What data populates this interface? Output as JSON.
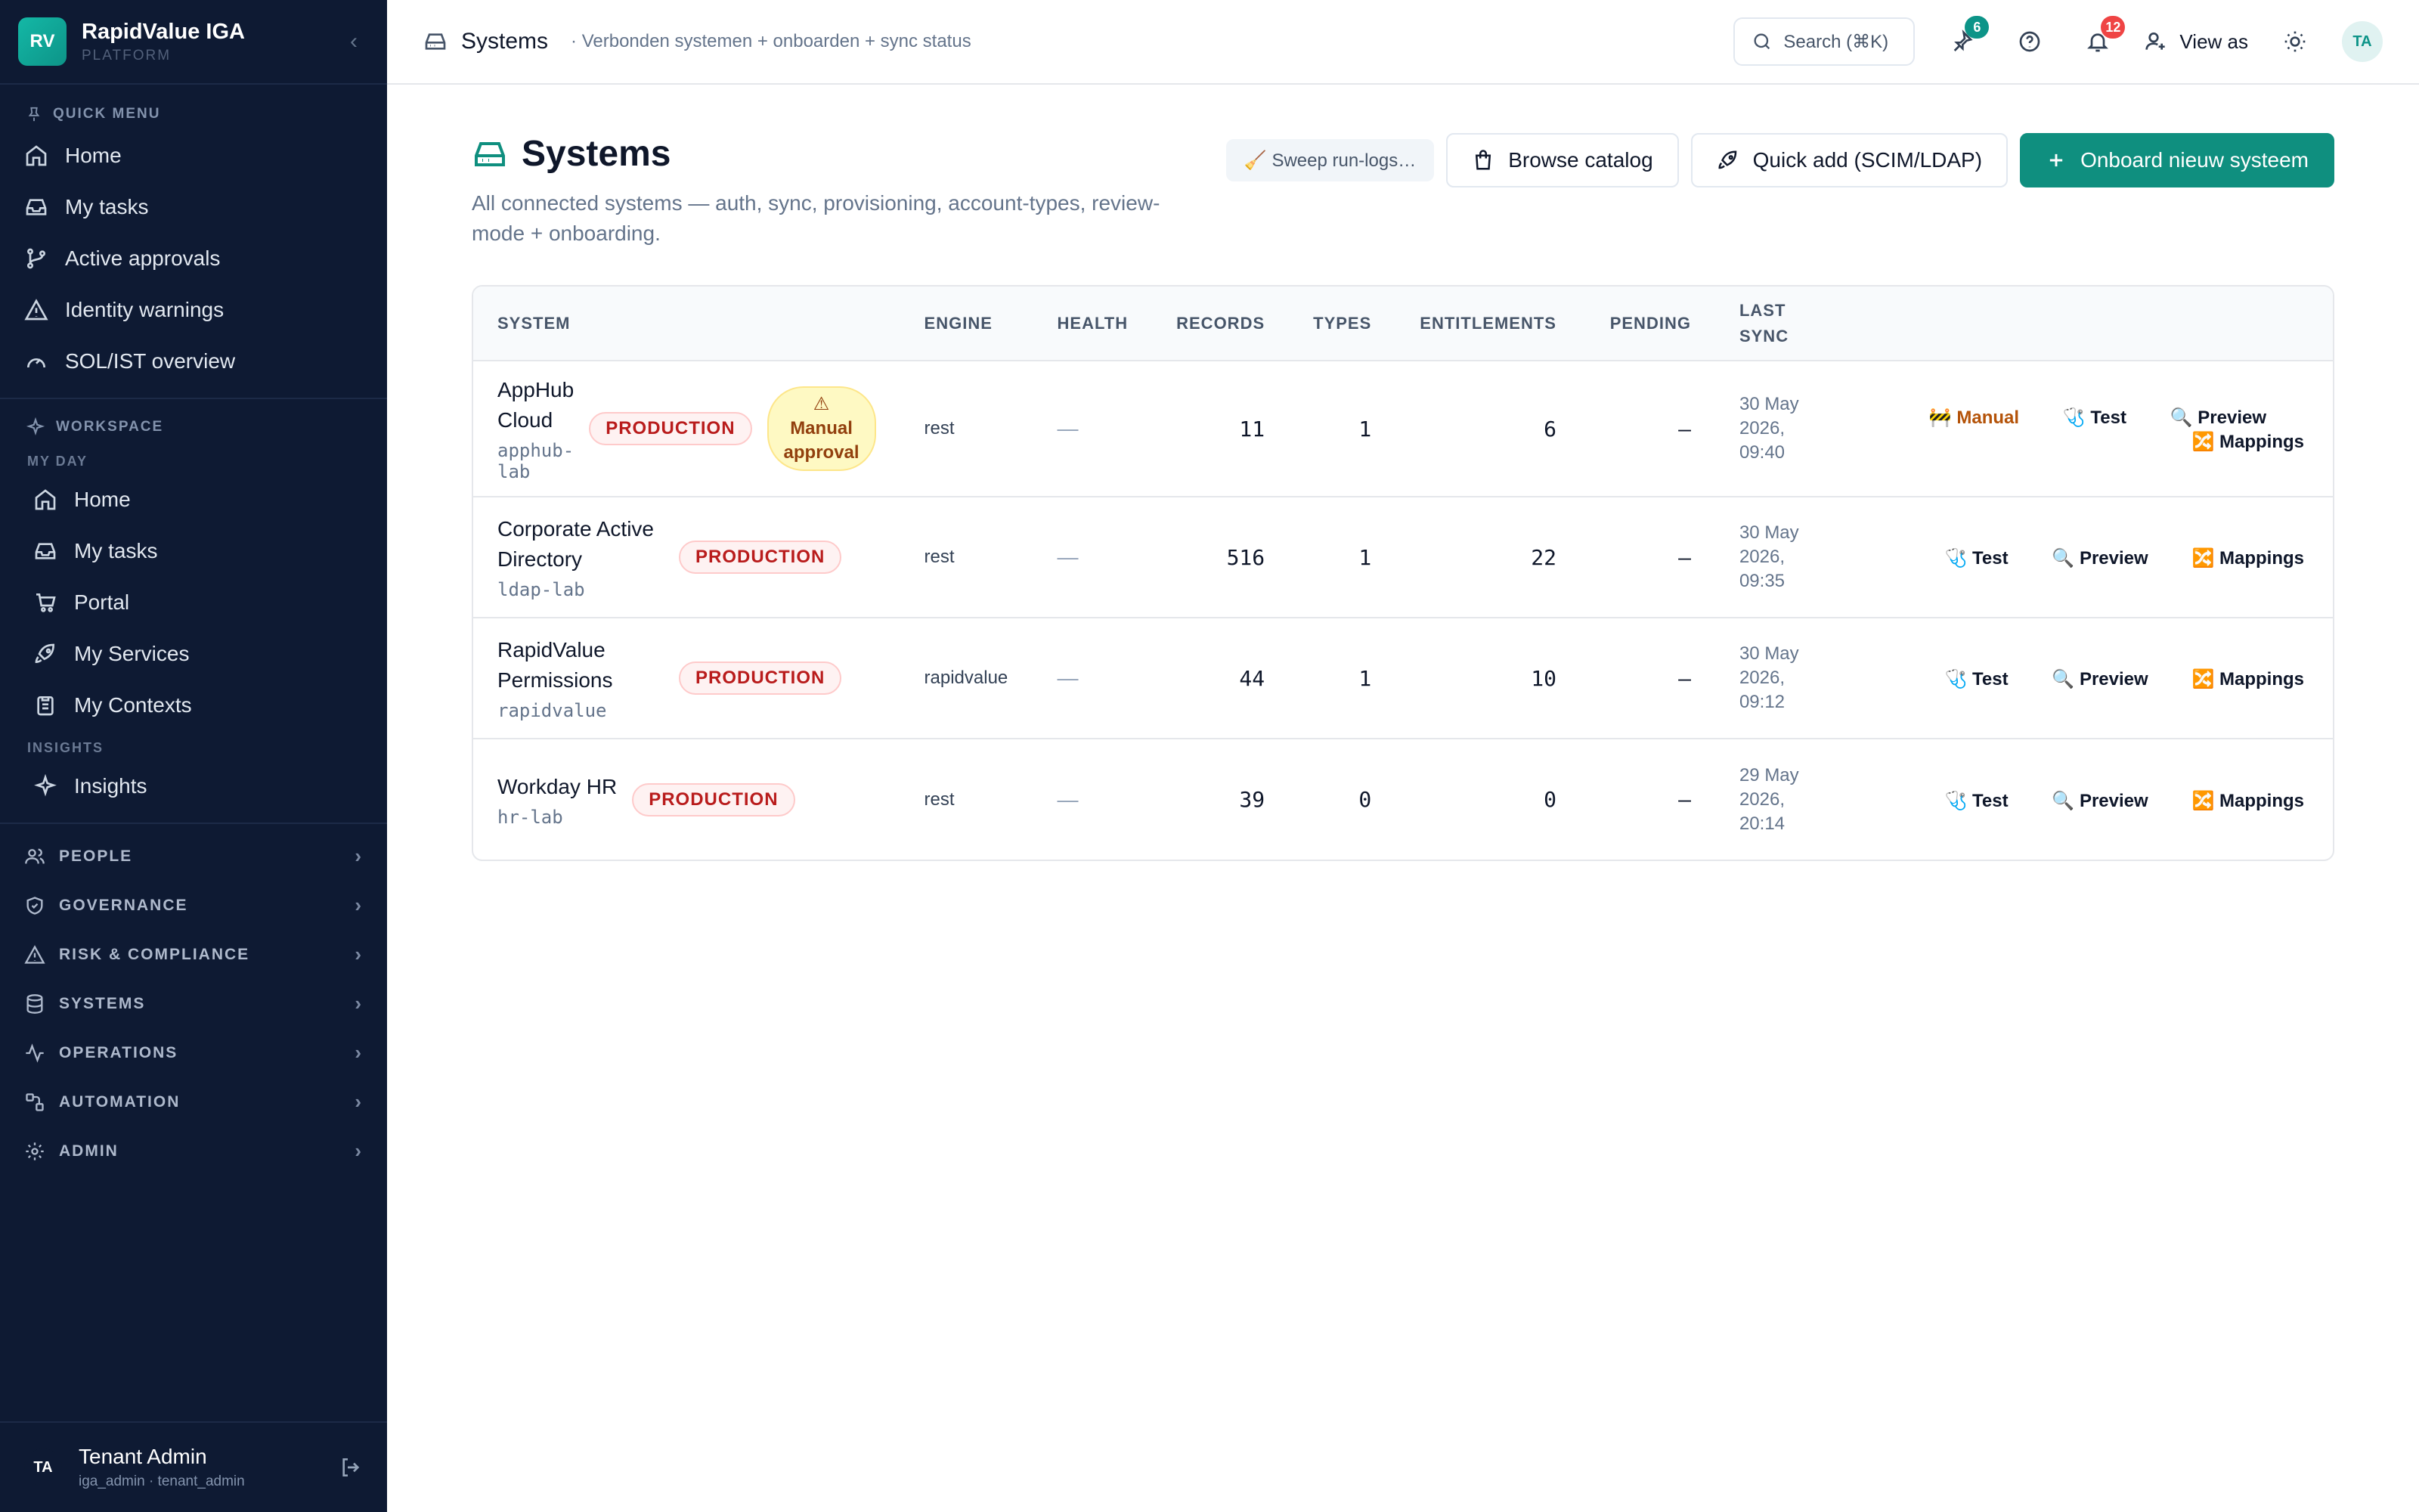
{
  "brand": {
    "logo": "RV",
    "name": "RapidValue IGA",
    "subtitle": "PLATFORM",
    "collapse_icon": "‹"
  },
  "quick_menu": {
    "label": "QUICK MENU",
    "items": [
      {
        "label": "Home",
        "icon": "home-icon"
      },
      {
        "label": "My tasks",
        "icon": "inbox-icon"
      },
      {
        "label": "Active approvals",
        "icon": "git-branch-icon"
      },
      {
        "label": "Identity warnings",
        "icon": "warning-icon"
      },
      {
        "label": "SOL/IST overview",
        "icon": "gauge-icon"
      }
    ]
  },
  "workspace": {
    "label": "WORKSPACE",
    "my_day_label": "MY DAY",
    "my_day": [
      {
        "label": "Home",
        "icon": "home-icon"
      },
      {
        "label": "My tasks",
        "icon": "inbox-icon"
      },
      {
        "label": "Portal",
        "icon": "cart-icon"
      },
      {
        "label": "My Services",
        "icon": "rocket-icon"
      },
      {
        "label": "My Contexts",
        "icon": "clipboard-icon"
      }
    ],
    "insights_label": "INSIGHTS",
    "insights": [
      {
        "label": "Insights",
        "icon": "sparkles-icon"
      }
    ]
  },
  "groups": [
    {
      "label": "PEOPLE",
      "icon": "users-icon"
    },
    {
      "label": "GOVERNANCE",
      "icon": "shield-icon"
    },
    {
      "label": "RISK & COMPLIANCE",
      "icon": "warning-icon"
    },
    {
      "label": "SYSTEMS",
      "icon": "database-icon"
    },
    {
      "label": "OPERATIONS",
      "icon": "activity-icon"
    },
    {
      "label": "AUTOMATION",
      "icon": "workflow-icon"
    },
    {
      "label": "ADMIN",
      "icon": "gear-icon"
    }
  ],
  "user": {
    "initials": "TA",
    "name": "Tenant Admin",
    "role": "iga_admin · tenant_admin"
  },
  "topbar": {
    "title": "Systems",
    "subtitle": "· Verbonden systemen + onboarden + sync status",
    "search": "Search (⌘K)",
    "pins_count": "6",
    "notifications_count": "12",
    "view_as": "View as",
    "avatar": "TA"
  },
  "page": {
    "title": "Systems",
    "description": "All connected systems — auth, sync, provisioning, account-types, review-mode + onboarding.",
    "actions": {
      "sweep": "🧹 Sweep run-logs…",
      "browse": "Browse catalog",
      "quick_add": "Quick add (SCIM/LDAP)",
      "onboard": "Onboard nieuw systeem"
    }
  },
  "table": {
    "headers": {
      "system": "SYSTEM",
      "engine": "ENGINE",
      "health": "HEALTH",
      "records": "RECORDS",
      "types": "TYPES",
      "entitlements": "ENTITLEMENTS",
      "pending": "PENDING",
      "last_sync": "LAST SYNC"
    },
    "rows": [
      {
        "name": "AppHub Cloud",
        "code": "apphub-lab",
        "env": "PRODUCTION",
        "warn": "⚠ Manual approval",
        "engine": "rest",
        "health": "—",
        "records": "11",
        "types": "1",
        "entitlements": "6",
        "pending": "—",
        "last_sync": "30 May 2026, 09:40",
        "manual": "🚧 Manual",
        "test": "🩺 Test",
        "preview": "🔍 Preview",
        "mappings": "🔀 Mappings"
      },
      {
        "name": "Corporate Active Directory",
        "code": "ldap-lab",
        "env": "PRODUCTION",
        "warn": "",
        "engine": "rest",
        "health": "—",
        "records": "516",
        "types": "1",
        "entitlements": "22",
        "pending": "—",
        "last_sync": "30 May 2026, 09:35",
        "manual": "",
        "test": "🩺 Test",
        "preview": "🔍 Preview",
        "mappings": "🔀 Mappings"
      },
      {
        "name": "RapidValue Permissions",
        "code": "rapidvalue",
        "env": "PRODUCTION",
        "warn": "",
        "engine": "rapidvalue",
        "health": "—",
        "records": "44",
        "types": "1",
        "entitlements": "10",
        "pending": "—",
        "last_sync": "30 May 2026, 09:12",
        "manual": "",
        "test": "🩺 Test",
        "preview": "🔍 Preview",
        "mappings": "🔀 Mappings"
      },
      {
        "name": "Workday HR",
        "code": "hr-lab",
        "env": "PRODUCTION",
        "warn": "",
        "engine": "rest",
        "health": "—",
        "records": "39",
        "types": "0",
        "entitlements": "0",
        "pending": "—",
        "last_sync": "29 May 2026, 20:14",
        "manual": "",
        "test": "🩺 Test",
        "preview": "🔍 Preview",
        "mappings": "🔀 Mappings"
      }
    ]
  },
  "colors": {
    "accent": "#0f8f7f",
    "sidebar": "#0e1a33",
    "danger": "#b91c1c",
    "warn": "#b45309"
  }
}
